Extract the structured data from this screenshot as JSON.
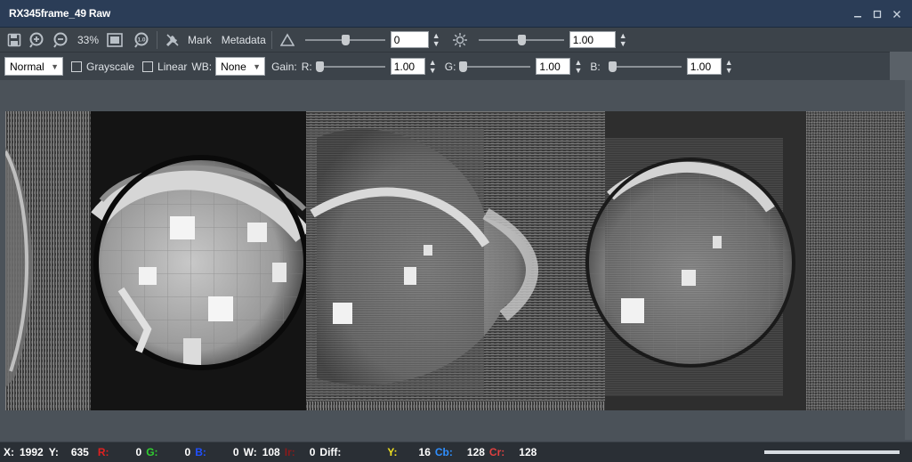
{
  "window": {
    "title": "RX345frame_49 Raw"
  },
  "toolbar1": {
    "zoom": "33%",
    "mark_label": "Mark",
    "metadata_label": "Metadata",
    "offset_value": "0",
    "brightness_value": "1.00",
    "offset_slider_fraction": 0.5,
    "brightness_slider_fraction": 0.5
  },
  "toolbar2": {
    "mode_value": "Normal",
    "grayscale_label": "Grayscale",
    "linear_label": "Linear",
    "wb_label": "WB:",
    "wb_value": "None",
    "gain_label": "Gain:",
    "r_label": "R:",
    "r_value": "1.00",
    "g_label": "G:",
    "g_value": "1.00",
    "b_label": "B:",
    "b_value": "1.00",
    "r_slider_fraction": 0.0,
    "g_slider_fraction": 0.0,
    "b_slider_fraction": 0.0
  },
  "status": {
    "x_label": "X:",
    "x_value": "1992",
    "y_label": "Y:",
    "y_value": "635",
    "r_label": "R:",
    "r_value": "0",
    "g_label": "G:",
    "g_value": "0",
    "b_label": "B:",
    "b_value": "0",
    "w_label": "W:",
    "w_value": "108",
    "ir_label": "Ir:",
    "ir_value": "0",
    "diff_label": "Diff:",
    "yy_label": "Y:",
    "yy_value": "16",
    "cb_label": "Cb:",
    "cb_value": "128",
    "cr_label": "Cr:",
    "cr_value": "128",
    "progress_fraction": 1.0
  },
  "colors": {
    "r": "#e02020",
    "g": "#30d030",
    "b": "#2050ff",
    "ir": "#8a1a1a",
    "y": "#f0e020",
    "cb": "#2f8fff",
    "cr": "#e04040"
  },
  "icons": [
    "save-icon",
    "zoom-in-icon",
    "zoom-out-icon",
    "fit-screen-icon",
    "actual-size-icon",
    "wrench-icon",
    "contrast-triangle-icon",
    "brightness-sun-icon"
  ]
}
